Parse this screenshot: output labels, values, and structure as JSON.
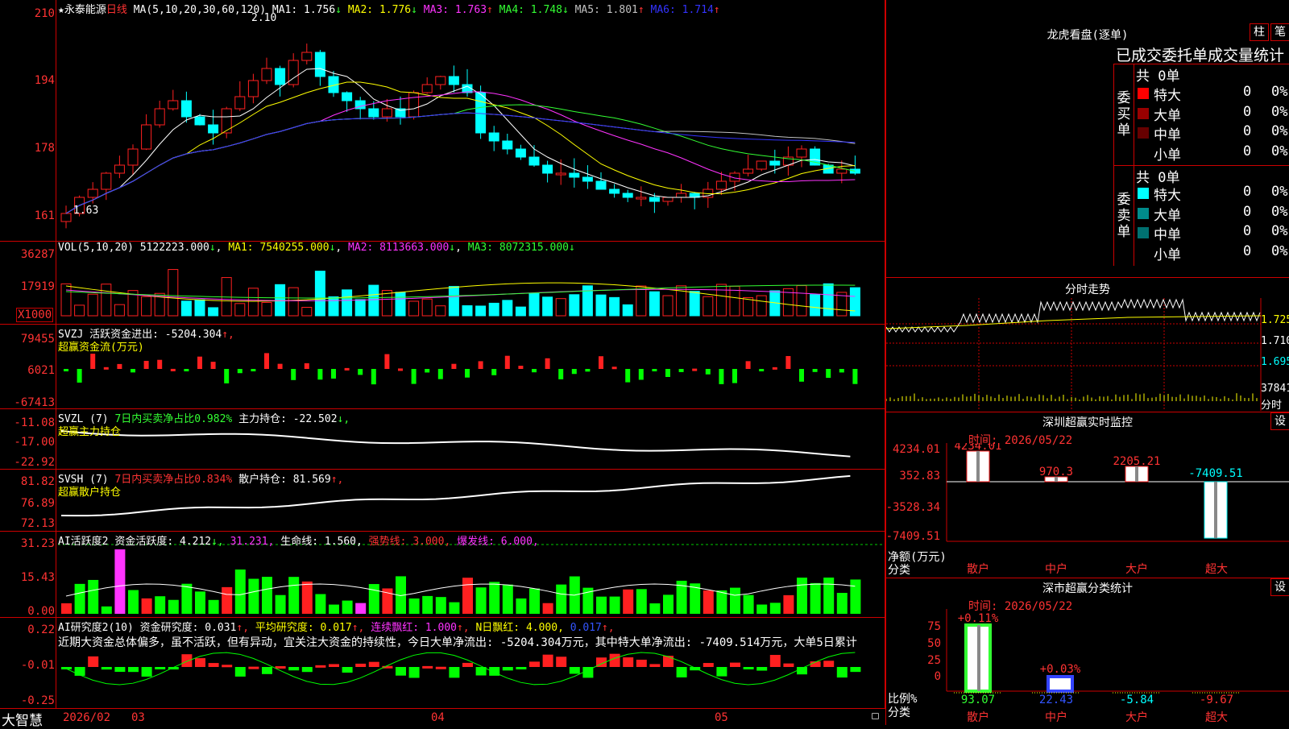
{
  "stock": {
    "star": "★",
    "name": "永泰能源",
    "period": "日线",
    "ma_header": "MA(5,10,20,30,60,120)",
    "ma": [
      {
        "label": "MA1:",
        "value": "1.756",
        "arrow": "↓",
        "color": "#ffffff"
      },
      {
        "label": "MA2:",
        "value": "1.776",
        "arrow": "↓",
        "color": "#ffff00"
      },
      {
        "label": "MA3:",
        "value": "1.763",
        "arrow": "↑",
        "color": "#ff33ff"
      },
      {
        "label": "MA4:",
        "value": "1.748",
        "arrow": "↓",
        "color": "#33ff33"
      },
      {
        "label": "MA5:",
        "value": "1.801",
        "arrow": "↑",
        "color": "#c0c0c0"
      },
      {
        "label": "MA6:",
        "value": "1.714",
        "arrow": "↑",
        "color": "#3333ff"
      }
    ],
    "high_mark": "2.10",
    "low_mark": "1.63"
  },
  "price_axis": [
    "210",
    "194",
    "178",
    "161"
  ],
  "vol": {
    "header": "VOL(5,10,20)",
    "value": "5122223.000",
    "arrow": "↓",
    "ma1": "MA1: 7540255.000",
    "ma1_arrow": "↓",
    "ma2": "MA2: 8113663.000",
    "ma2_arrow": "↓",
    "ma3": "MA3: 8072315.000",
    "ma3_arrow": "↓",
    "axis": [
      "36287",
      "17919"
    ],
    "unit": "X1000"
  },
  "svzj": {
    "title": "SVZJ  活跃资金进出: -5204.304",
    "arrow": "↑,",
    "subtitle": "超赢资金流(万元)",
    "axis": [
      "79455",
      "6021",
      "-67413"
    ]
  },
  "svzl": {
    "title": "SVZL (7)",
    "title2": "7日内买卖净占比0.982%",
    "title3": "主力持仓: -22.502",
    "arrow": "↓,",
    "subtitle": "超赢主力持仓",
    "axis": [
      "-11.08",
      "-17.00",
      "-22.92"
    ]
  },
  "svsh": {
    "title": "SVSH (7)",
    "title2": "7日内买卖净占比0.834%",
    "title3": "散户持仓: 81.569",
    "arrow": "↑,",
    "subtitle": "超赢散户持仓",
    "axis": [
      "81.82",
      "76.89",
      "72.13"
    ]
  },
  "ai_act": {
    "t1": "AI活跃度2",
    "t2": "资金活跃度: 4.212",
    "t2a": "↓,",
    "t3": "31.231,",
    "t4": "生命线: 1.560,",
    "t5": "强势线: 3.000,",
    "t6": "爆发线: 6.000,",
    "axis": [
      "31.23",
      "15.43",
      "0.00"
    ]
  },
  "ai_res": {
    "t1": "AI研究度2(10)",
    "t2": "资金研究度: 0.031",
    "t2a": "↑,",
    "t3": "平均研究度: 0.017",
    "t3a": "↑,",
    "t4": "连续飘红: 1.000",
    "t4a": "↑,",
    "t5": "N日飘红: 4.000,",
    "t6": "0.017",
    "t6a": "↑,",
    "comment": "近期大资金总体偏多，虽不活跃，但有异动，宜关注大资金的持续性，今日大单净流出: -5204.304万元，其中特大单净流出: -7409.514万元，大单5日累计",
    "axis": [
      "0.22",
      "-0.01",
      "-0.25"
    ]
  },
  "bottom": {
    "logo": "大智慧",
    "dates": [
      "2026/02",
      "03",
      "04",
      "05"
    ]
  },
  "dragon": {
    "title": "龙虎看盘(逐单)",
    "btn1": "柱",
    "btn2": "笔",
    "header": "已成交委托单成交量统计",
    "buy_label": [
      "委",
      "买",
      "单"
    ],
    "sell_label": [
      "委",
      "卖",
      "单"
    ],
    "buy_total": "共 0单",
    "sell_total": "共 0单",
    "buy_rows": [
      {
        "name": "特大",
        "n": "0",
        "p": "0%",
        "color": "#ff0000"
      },
      {
        "name": "大单",
        "n": "0",
        "p": "0%",
        "color": "#990000"
      },
      {
        "name": "中单",
        "n": "0",
        "p": "0%",
        "color": "#660000"
      },
      {
        "name": "小单",
        "n": "0",
        "p": "0%",
        "color": ""
      }
    ],
    "sell_rows": [
      {
        "name": "特大",
        "n": "0",
        "p": "0%",
        "color": "#00ffff"
      },
      {
        "name": "大单",
        "n": "0",
        "p": "0%",
        "color": "#008b8b"
      },
      {
        "name": "中单",
        "n": "0",
        "p": "0%",
        "color": "#007070"
      },
      {
        "name": "小单",
        "n": "0",
        "p": "0%",
        "color": ""
      }
    ]
  },
  "intraday": {
    "title": "分时走势",
    "axis": [
      "1.725",
      "1.710",
      "1.695",
      "37841",
      "分时"
    ]
  },
  "sz_monitor": {
    "title": "深圳超赢实时监控",
    "btn": "设",
    "time": "时间: 2026/05/22",
    "axis": [
      "4234.01",
      "352.83",
      "-3528.34",
      "-7409.51"
    ],
    "ylabel": "净额(万元)",
    "xlabel": "分类",
    "categories": [
      "散户",
      "中户",
      "大户",
      "超大"
    ],
    "values": [
      "4234.01",
      "970.3",
      "2205.21",
      "-7409.51"
    ]
  },
  "sz_class": {
    "title": "深市超赢分类统计",
    "btn": "设",
    "time": "时间: 2026/05/22",
    "ylabel": "比例%",
    "xlabel": "分类",
    "axis": [
      "75",
      "50",
      "25",
      "0"
    ],
    "top_labels": [
      "+0.11%",
      "+0.03%"
    ],
    "bottom_values": [
      "93.07",
      "22.43",
      "-5.84",
      "-9.67"
    ],
    "categories": [
      "散户",
      "中户",
      "大户",
      "超大"
    ]
  }
}
